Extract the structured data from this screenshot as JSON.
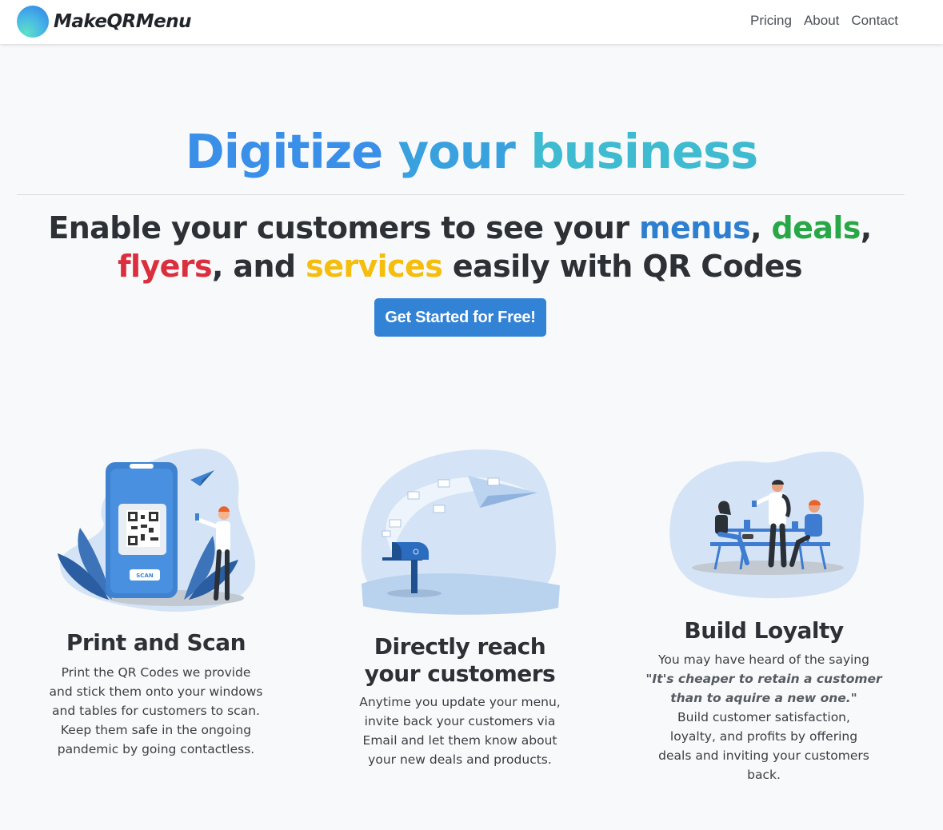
{
  "nav": {
    "brand": "MakeQRMenu",
    "links": [
      "Pricing",
      "About",
      "Contact"
    ]
  },
  "hero": {
    "title_words": [
      "Digitize",
      "your",
      "business"
    ],
    "subtitle": {
      "p1": "Enable your customers to see your ",
      "menus": "menus",
      "comma1": ", ",
      "deals": "deals",
      "comma2": ",",
      "flyers": "flyers",
      "p2": ", and ",
      "services": "services",
      "p3": " easily with QR Codes"
    },
    "cta": "Get Started for Free!"
  },
  "colors": {
    "brand_blue": "#3282d6",
    "menus": "#2f7fd0",
    "deals": "#27a745",
    "flyers": "#dc2f3e",
    "services": "#f5bd0c"
  },
  "features": [
    {
      "title": "Print and Scan",
      "text_lines": [
        "Print the QR Codes we provide",
        "and stick them onto your windows",
        "and tables for customers to scan.",
        "Keep them safe in the ongoing",
        "pandemic by going contactless."
      ],
      "illustration_scan_label": "SCAN"
    },
    {
      "title_lines": [
        "Directly reach",
        "your customers"
      ],
      "text_lines": [
        "Anytime you update your menu,",
        "invite back your customers via",
        "Email and let them know about",
        "your new deals and products."
      ]
    },
    {
      "title": "Build Loyalty",
      "text_intro": "You may have heard of the saying",
      "quote_lines": [
        "\"It's cheaper to retain a customer",
        "than to aquire a new one.\""
      ],
      "text_lines": [
        "Build customer satisfaction,",
        "loyalty, and profits by offering",
        "deals and inviting your customers",
        "back."
      ]
    }
  ]
}
